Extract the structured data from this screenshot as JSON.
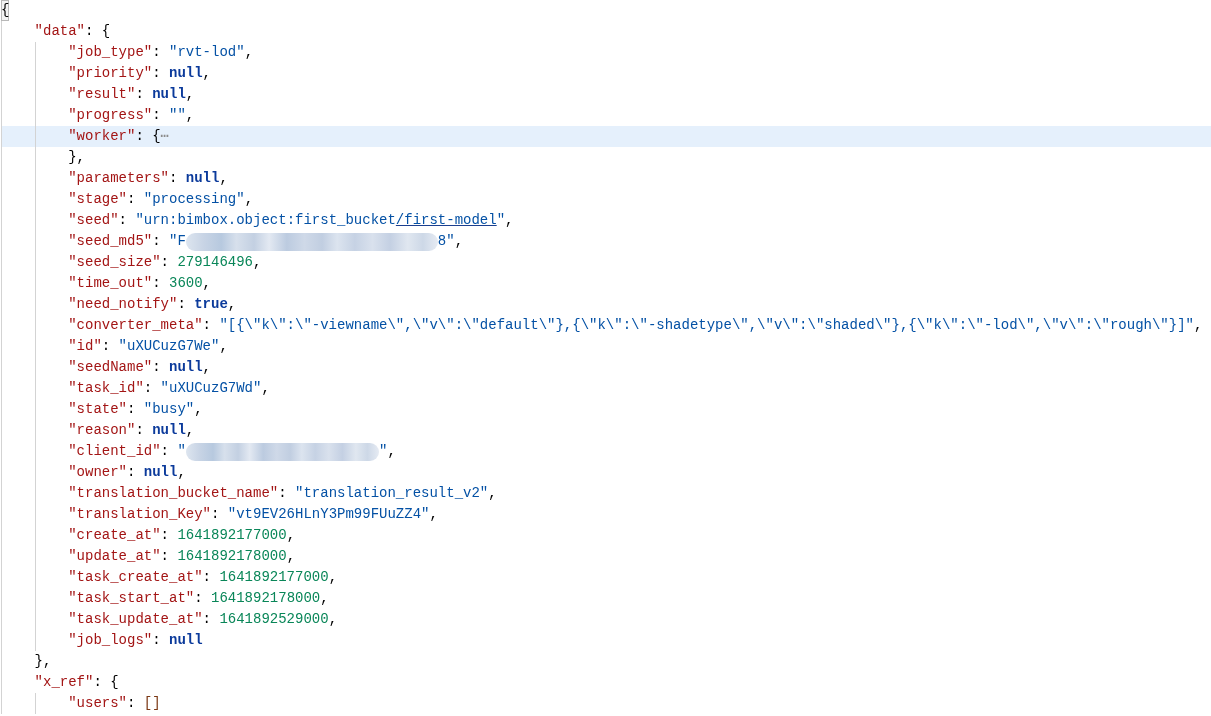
{
  "editor": {
    "root": {
      "kind": "object",
      "open": "{",
      "matched": true,
      "selected": false,
      "children": [
        {
          "key": "\"data\"",
          "colon": ":",
          "kind": "object",
          "open": "{",
          "matched": false,
          "selected": false,
          "children": [
            {
              "key": "\"job_type\"",
              "colon": ":",
              "kind": "string",
              "value": "\"rvt-lod\"",
              "comma": ",",
              "selected": false
            },
            {
              "key": "\"priority\"",
              "colon": ":",
              "kind": "literal",
              "value": "null",
              "comma": ",",
              "selected": false
            },
            {
              "key": "\"result\"",
              "colon": ":",
              "kind": "literal",
              "value": "null",
              "comma": ",",
              "selected": false
            },
            {
              "key": "\"progress\"",
              "colon": ":",
              "kind": "string",
              "value": "\"\"",
              "comma": ",",
              "selected": false
            },
            {
              "key": "\"worker\"",
              "colon": ":",
              "kind": "folded",
              "open": "{",
              "fold_mark": "⋯",
              "close": "}",
              "comma": ",",
              "selected": true
            },
            {
              "key": "\"parameters\"",
              "colon": ":",
              "kind": "literal",
              "value": "null",
              "comma": ",",
              "selected": false
            },
            {
              "key": "\"stage\"",
              "colon": ":",
              "kind": "string",
              "value": "\"processing\"",
              "comma": ",",
              "selected": false
            },
            {
              "key": "\"seed\"",
              "colon": ":",
              "kind": "linked_string",
              "value": "\"urn:bimbox.object:first_bucket",
              "link": "/first-model",
              "value_end": "\"",
              "comma": ",",
              "selected": false
            },
            {
              "key": "\"seed_md5\"",
              "colon": ":",
              "kind": "redacted",
              "value": "\"F",
              "value_end": "8\"",
              "comma": ",",
              "selected": false
            },
            {
              "key": "\"seed_size\"",
              "colon": ":",
              "kind": "number",
              "value": "279146496",
              "comma": ",",
              "selected": false
            },
            {
              "key": "\"time_out\"",
              "colon": ":",
              "kind": "number",
              "value": "3600",
              "comma": ",",
              "selected": false
            },
            {
              "key": "\"need_notify\"",
              "colon": ":",
              "kind": "literal",
              "value": "true",
              "comma": ",",
              "selected": false
            },
            {
              "key": "\"converter_meta\"",
              "colon": ":",
              "kind": "string",
              "value": "\"[{\\\"k\\\":\\\"-viewname\\\",\\\"v\\\":\\\"default\\\"},{\\\"k\\\":\\\"-shadetype\\\",\\\"v\\\":\\\"shaded\\\"},{\\\"k\\\":\\\"-lod\\\",\\\"v\\\":\\\"rough\\\"}]\"",
              "comma": ",",
              "selected": false
            },
            {
              "key": "\"id\"",
              "colon": ":",
              "kind": "string",
              "value": "\"uXUCuzG7We\"",
              "comma": ",",
              "selected": false
            },
            {
              "key": "\"seedName\"",
              "colon": ":",
              "kind": "literal",
              "value": "null",
              "comma": ",",
              "selected": false
            },
            {
              "key": "\"task_id\"",
              "colon": ":",
              "kind": "string",
              "value": "\"uXUCuzG7Wd\"",
              "comma": ",",
              "selected": false
            },
            {
              "key": "\"state\"",
              "colon": ":",
              "kind": "string",
              "value": "\"busy\"",
              "comma": ",",
              "selected": false
            },
            {
              "key": "\"reason\"",
              "colon": ":",
              "kind": "literal",
              "value": "null",
              "comma": ",",
              "selected": false
            },
            {
              "key": "\"client_id\"",
              "colon": ":",
              "kind": "redacted",
              "value": "\"",
              "value_end": "\"",
              "comma": ",",
              "selected": false
            },
            {
              "key": "\"owner\"",
              "colon": ":",
              "kind": "literal",
              "value": "null",
              "comma": ",",
              "selected": false
            },
            {
              "key": "\"translation_bucket_name\"",
              "colon": ":",
              "kind": "string",
              "value": "\"translation_result_v2\"",
              "comma": ",",
              "selected": false
            },
            {
              "key": "\"translation_Key\"",
              "colon": ":",
              "kind": "string",
              "value": "\"vt9EV26HLnY3Pm99FUuZZ4\"",
              "comma": ",",
              "selected": false
            },
            {
              "key": "\"create_at\"",
              "colon": ":",
              "kind": "number",
              "value": "1641892177000",
              "comma": ",",
              "selected": false
            },
            {
              "key": "\"update_at\"",
              "colon": ":",
              "kind": "number",
              "value": "1641892178000",
              "comma": ",",
              "selected": false
            },
            {
              "key": "\"task_create_at\"",
              "colon": ":",
              "kind": "number",
              "value": "1641892177000",
              "comma": ",",
              "selected": false
            },
            {
              "key": "\"task_start_at\"",
              "colon": ":",
              "kind": "number",
              "value": "1641892178000",
              "comma": ",",
              "selected": false
            },
            {
              "key": "\"task_update_at\"",
              "colon": ":",
              "kind": "number",
              "value": "1641892529000",
              "comma": ",",
              "selected": false
            },
            {
              "key": "\"job_logs\"",
              "colon": ":",
              "kind": "literal",
              "value": "null",
              "selected": false
            }
          ],
          "close": "}",
          "comma": ","
        },
        {
          "key": "\"x_ref\"",
          "colon": ":",
          "kind": "object",
          "open": "{",
          "matched": false,
          "selected": false,
          "children": [
            {
              "key": "\"users\"",
              "colon": ":",
              "kind": "array",
              "value": "[]",
              "selected": false
            }
          ]
        }
      ]
    }
  }
}
